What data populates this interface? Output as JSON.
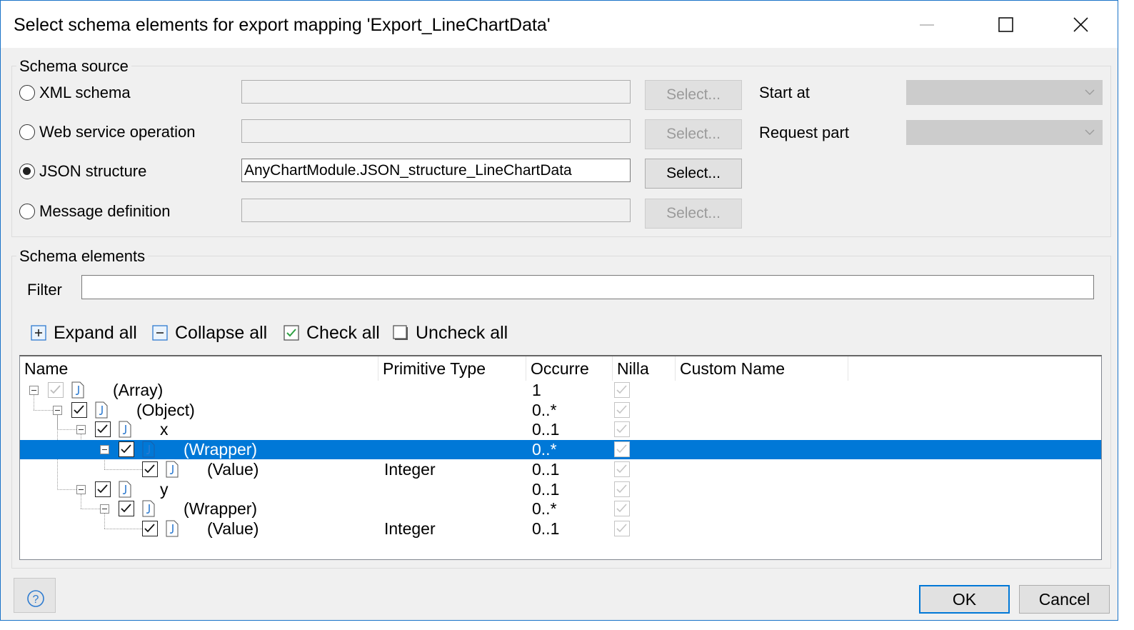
{
  "window": {
    "title": "Select schema elements for export mapping 'Export_LineChartData'"
  },
  "schema_source": {
    "group_label": "Schema source",
    "options": [
      {
        "label": "XML schema",
        "selected": false,
        "value": "",
        "button": "Select..."
      },
      {
        "label": "Web service operation",
        "selected": false,
        "value": "",
        "button": "Select..."
      },
      {
        "label": "JSON structure",
        "selected": true,
        "value": "AnyChartModule.JSON_structure_LineChartData",
        "button": "Select..."
      },
      {
        "label": "Message definition",
        "selected": false,
        "value": "",
        "button": "Select..."
      }
    ],
    "start_at_label": "Start at",
    "request_part_label": "Request part"
  },
  "schema_elements": {
    "group_label": "Schema elements",
    "filter_label": "Filter",
    "filter_value": "",
    "toolbar": {
      "expand_all": "Expand all",
      "collapse_all": "Collapse all",
      "check_all": "Check all",
      "uncheck_all": "Uncheck all"
    },
    "columns": [
      "Name",
      "Primitive Type",
      "Occurre",
      "Nilla",
      "Custom Name"
    ],
    "rows": [
      {
        "name": "(Array)",
        "type": "",
        "occurs": "1",
        "level": 0,
        "expandable": true,
        "checked": true,
        "dim": true,
        "selected": false
      },
      {
        "name": "(Object)",
        "type": "",
        "occurs": "0..*",
        "level": 1,
        "expandable": true,
        "checked": true,
        "dim": false,
        "selected": false
      },
      {
        "name": "x",
        "type": "",
        "occurs": "0..1",
        "level": 2,
        "expandable": true,
        "checked": true,
        "dim": false,
        "selected": false
      },
      {
        "name": "(Wrapper)",
        "type": "",
        "occurs": "0..*",
        "level": 3,
        "expandable": true,
        "checked": true,
        "dim": false,
        "selected": true
      },
      {
        "name": "(Value)",
        "type": "Integer",
        "occurs": "0..1",
        "level": 4,
        "expandable": false,
        "checked": true,
        "dim": false,
        "selected": false
      },
      {
        "name": "y",
        "type": "",
        "occurs": "0..1",
        "level": 2,
        "expandable": true,
        "checked": true,
        "dim": false,
        "selected": false
      },
      {
        "name": "(Wrapper)",
        "type": "",
        "occurs": "0..*",
        "level": 3,
        "expandable": true,
        "checked": true,
        "dim": false,
        "selected": false
      },
      {
        "name": "(Value)",
        "type": "Integer",
        "occurs": "0..1",
        "level": 4,
        "expandable": false,
        "checked": true,
        "dim": false,
        "selected": false
      }
    ]
  },
  "buttons": {
    "ok": "OK",
    "cancel": "Cancel"
  },
  "colors": {
    "accent": "#0078d7",
    "window_border": "#1a73c8"
  }
}
